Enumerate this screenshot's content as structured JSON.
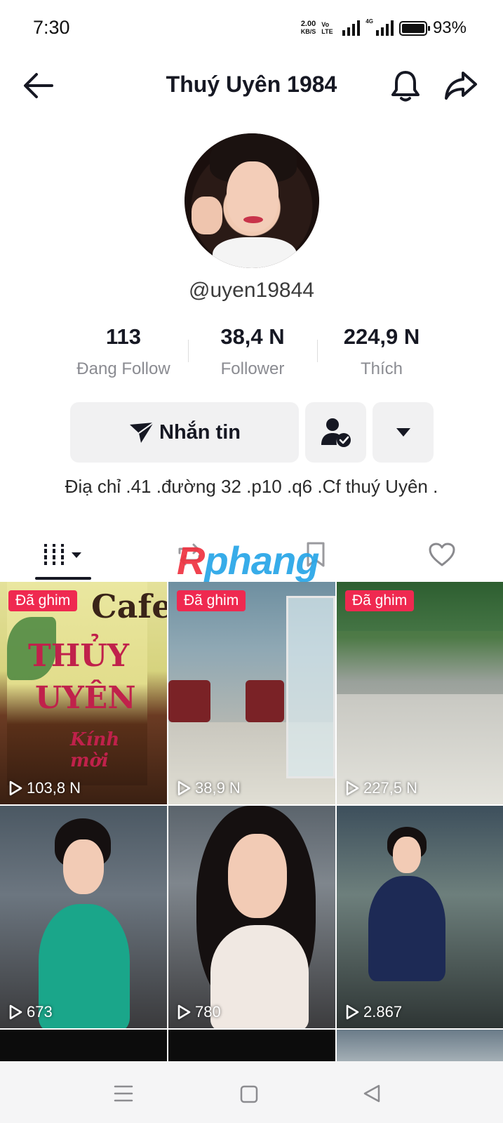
{
  "status_bar": {
    "time": "7:30",
    "net_speed_value": "2.00",
    "net_speed_unit": "KB/S",
    "volte": "Vo LTE",
    "network_type": "4G",
    "battery": "93%"
  },
  "header": {
    "title": "Thuý Uyên 1984"
  },
  "profile": {
    "username": "@uyen19844",
    "stats": [
      {
        "value": "113",
        "label": "Đang Follow"
      },
      {
        "value": "38,4 N",
        "label": "Follower"
      },
      {
        "value": "224,9 N",
        "label": "Thích"
      }
    ],
    "message_button": "Nhắn tin",
    "bio": "Điạ chỉ .41 .đường 32 .p10 .q6 .Cf thuý Uyên ."
  },
  "watermark": {
    "part1": "R",
    "part2": "phang"
  },
  "videos": [
    {
      "pinned_label": "Đã ghim",
      "views": "103,8 N",
      "sign": {
        "cafe": "Cafe",
        "line1": "THỦY",
        "line2": "UYÊN",
        "line3": "Kính mời"
      }
    },
    {
      "pinned_label": "Đã ghim",
      "views": "38,9 N"
    },
    {
      "pinned_label": "Đã ghim",
      "views": "227,5 N"
    },
    {
      "views": "673"
    },
    {
      "views": "780"
    },
    {
      "views": "2.867"
    }
  ],
  "colors": {
    "pin_badge": "#ef2950",
    "button_bg": "#f1f1f2",
    "text_primary": "#161823",
    "text_secondary": "#8a8b91"
  }
}
